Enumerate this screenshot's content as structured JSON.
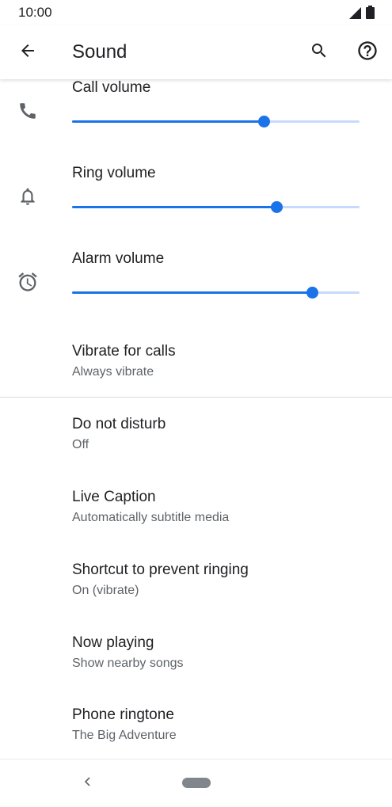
{
  "status_bar": {
    "time": "10:00",
    "icons": [
      "signal-icon",
      "battery-icon"
    ]
  },
  "app_bar": {
    "title": "Sound",
    "icons": [
      "back-arrow-icon",
      "search-icon",
      "help-icon"
    ]
  },
  "volumes": [
    {
      "label": "Call volume",
      "icon": "phone-icon",
      "level": 0.666
    },
    {
      "label": "Ring volume",
      "icon": "bell-icon",
      "level": 0.711
    },
    {
      "label": "Alarm volume",
      "icon": "alarm-clock-icon",
      "level": 0.835
    }
  ],
  "preferences": [
    {
      "title": "Vibrate for calls",
      "summary": "Always vibrate"
    },
    {
      "title": "Do not disturb",
      "summary": "Off"
    },
    {
      "title": "Live Caption",
      "summary": "Automatically subtitle media"
    },
    {
      "title": "Shortcut to prevent ringing",
      "summary": "On (vibrate)"
    },
    {
      "title": "Now playing",
      "summary": "Show nearby songs"
    },
    {
      "title": "Phone ringtone",
      "summary": "The Big Adventure"
    }
  ],
  "colors": {
    "accent": "#1a73e8",
    "track": "#c6dafc",
    "text_primary": "#202124",
    "text_secondary": "#5f6368",
    "icon": "#5f6368"
  },
  "nav_bar": {
    "icons": [
      "nav-back-icon",
      "home-pill-icon"
    ]
  }
}
